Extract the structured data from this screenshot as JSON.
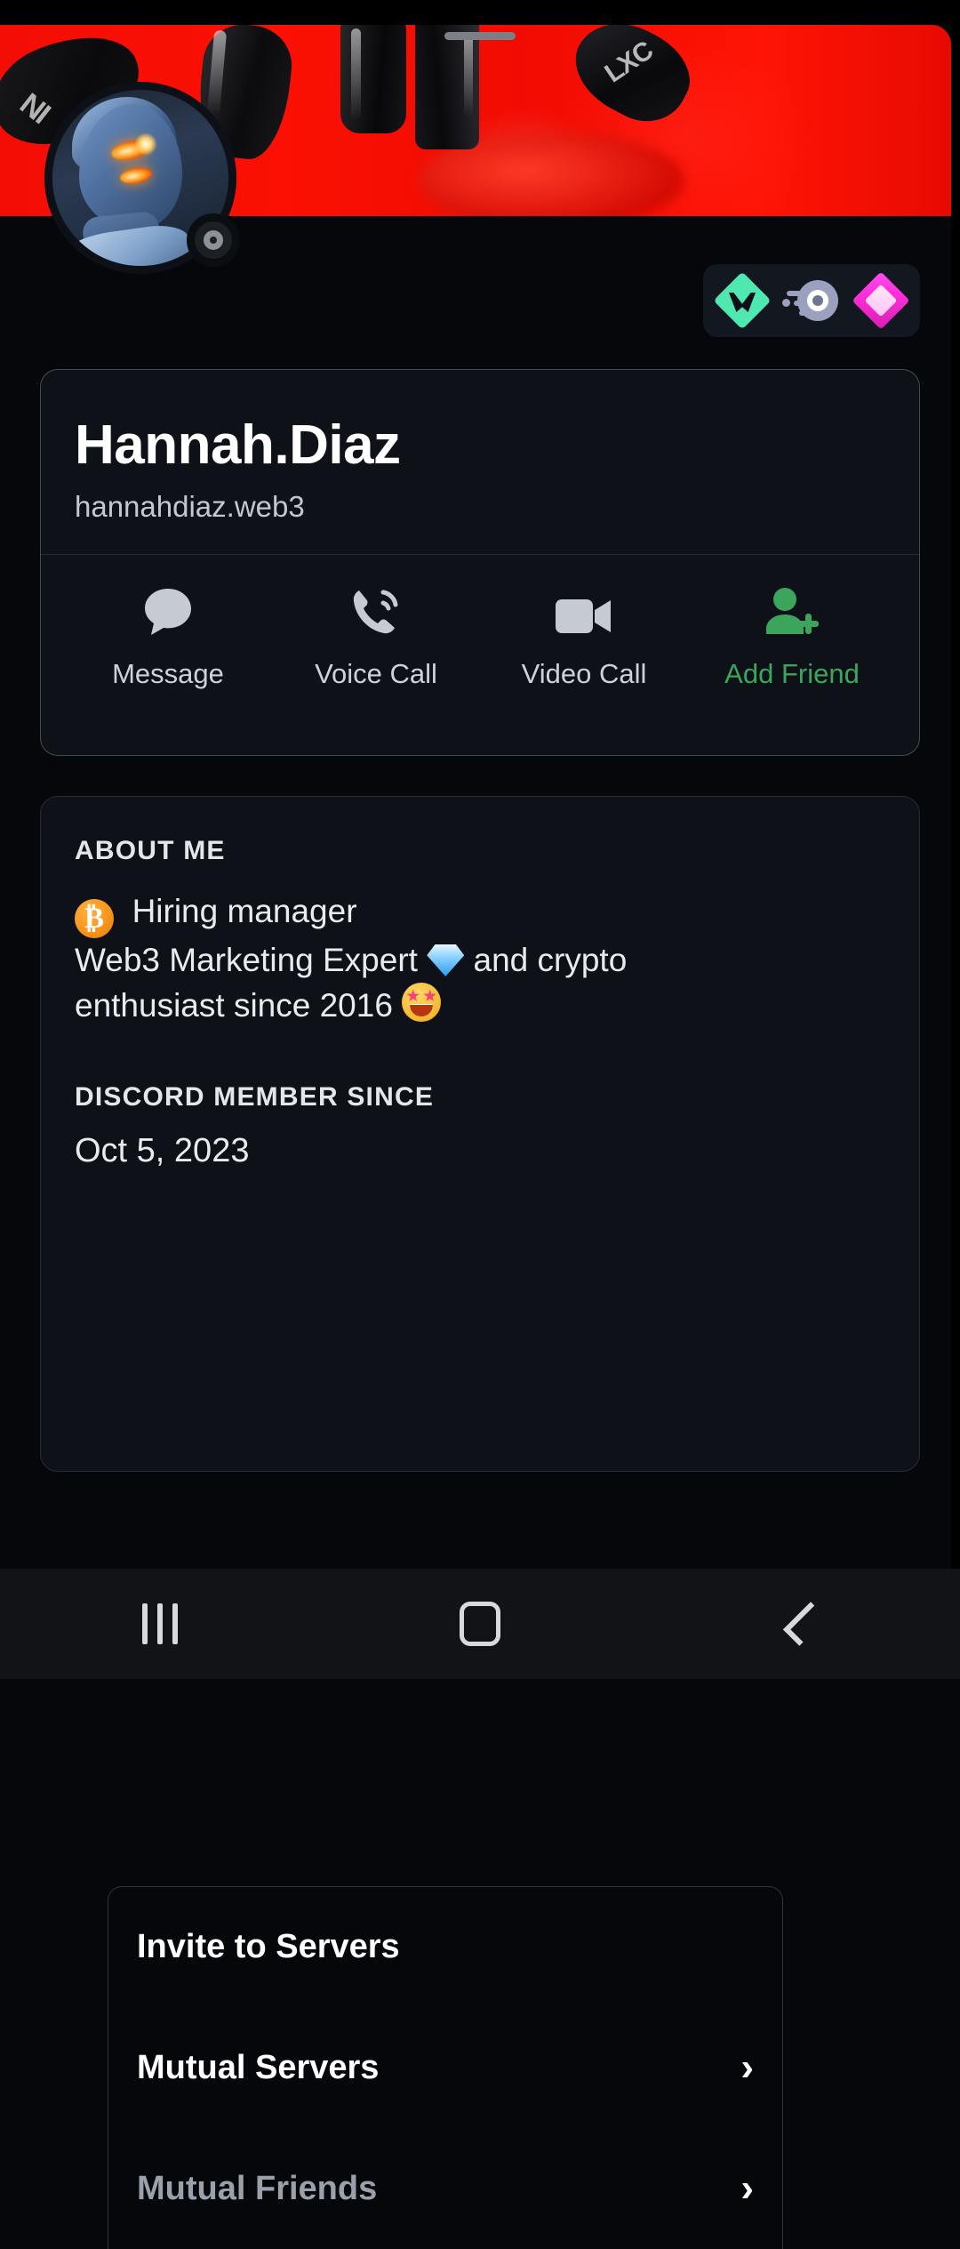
{
  "profile": {
    "display_name": "Hannah.Diaz",
    "username": "hannahdiaz.web3",
    "status": "offline",
    "banner_alt": "red-boxing-gloves-banner",
    "avatar_alt": "cyberpunk-woman-glowing-eyes-avatar"
  },
  "badges": [
    {
      "name": "ethereum-diamond-badge",
      "color": "#4fe8b0"
    },
    {
      "name": "speed-orb-badge",
      "color": "#9aa0bd"
    },
    {
      "name": "magenta-gem-badge",
      "color": "#ff2ddb"
    }
  ],
  "actions": [
    {
      "label": "Message",
      "icon": "message-icon",
      "color": "#cdd2d9"
    },
    {
      "label": "Voice Call",
      "icon": "phone-call-icon",
      "color": "#cdd2d9"
    },
    {
      "label": "Video Call",
      "icon": "video-camera-icon",
      "color": "#cdd2d9"
    },
    {
      "label": "Add Friend",
      "icon": "add-person-icon",
      "color": "#3ba55c"
    }
  ],
  "about": {
    "heading": "ABOUT ME",
    "bio_line1_emoji": "₿",
    "bio_line1": "Hiring manager",
    "bio_line2_a": "Web3 Marketing Expert",
    "bio_line2_b": "and crypto",
    "bio_line3": "enthusiast since 2016",
    "member_heading": "DISCORD MEMBER SINCE",
    "member_date": "Oct 5, 2023"
  },
  "list_items": [
    {
      "label": "Invite to Servers",
      "chevron": "",
      "dim": false
    },
    {
      "label": "Mutual Servers",
      "chevron": "›",
      "dim": false
    },
    {
      "label": "Mutual Friends",
      "chevron": "›",
      "dim": true
    }
  ],
  "navbar": [
    {
      "name": "recents-button"
    },
    {
      "name": "home-button"
    },
    {
      "name": "back-button"
    }
  ]
}
